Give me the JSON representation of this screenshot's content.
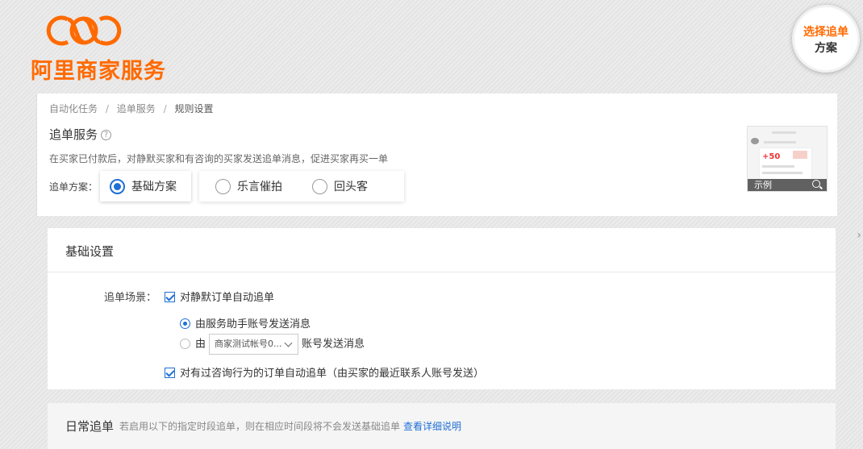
{
  "brand": {
    "name": "阿里商家服务",
    "color": "#ff6a00"
  },
  "badge": {
    "line1": "选择追单",
    "line2": "方案"
  },
  "breadcrumb": {
    "items": [
      "自动化任务",
      "追单服务",
      "规则设置"
    ],
    "separator": "/"
  },
  "service": {
    "title": "追单服务",
    "help_icon": "question-circle-icon",
    "description": "在买家已付款后，对静默买家和有咨询的买家发送追单消息，促进买家再买一单",
    "plan_label": "追单方案：",
    "plans": [
      {
        "label": "基础方案",
        "selected": true
      },
      {
        "label": "乐言催拍",
        "selected": false
      },
      {
        "label": "回头客",
        "selected": false
      }
    ],
    "example": {
      "label": "示例",
      "price": "+50",
      "icon": "zoom-icon"
    }
  },
  "basic": {
    "title": "基础设置",
    "scene_label": "追单场景：",
    "silent_checkbox": {
      "label": "对静默订单自动追单",
      "checked": true
    },
    "send_options": [
      {
        "label": "由服务助手账号发送消息",
        "selected": true
      },
      {
        "prefix": "由",
        "select_value": "商家测试帐号0...",
        "suffix": "账号发送消息",
        "selected": false
      }
    ],
    "consult_checkbox": {
      "label": "对有过咨询行为的订单自动追单（由买家的最近联系人账号发送）",
      "checked": true
    }
  },
  "daily": {
    "title": "日常追单",
    "description": "若启用以下的指定时段追单，则在相应时间段将不会发送基础追单",
    "link": "查看详细说明"
  },
  "colors": {
    "accent": "#1f6fd6",
    "brand": "#ff6a00"
  }
}
